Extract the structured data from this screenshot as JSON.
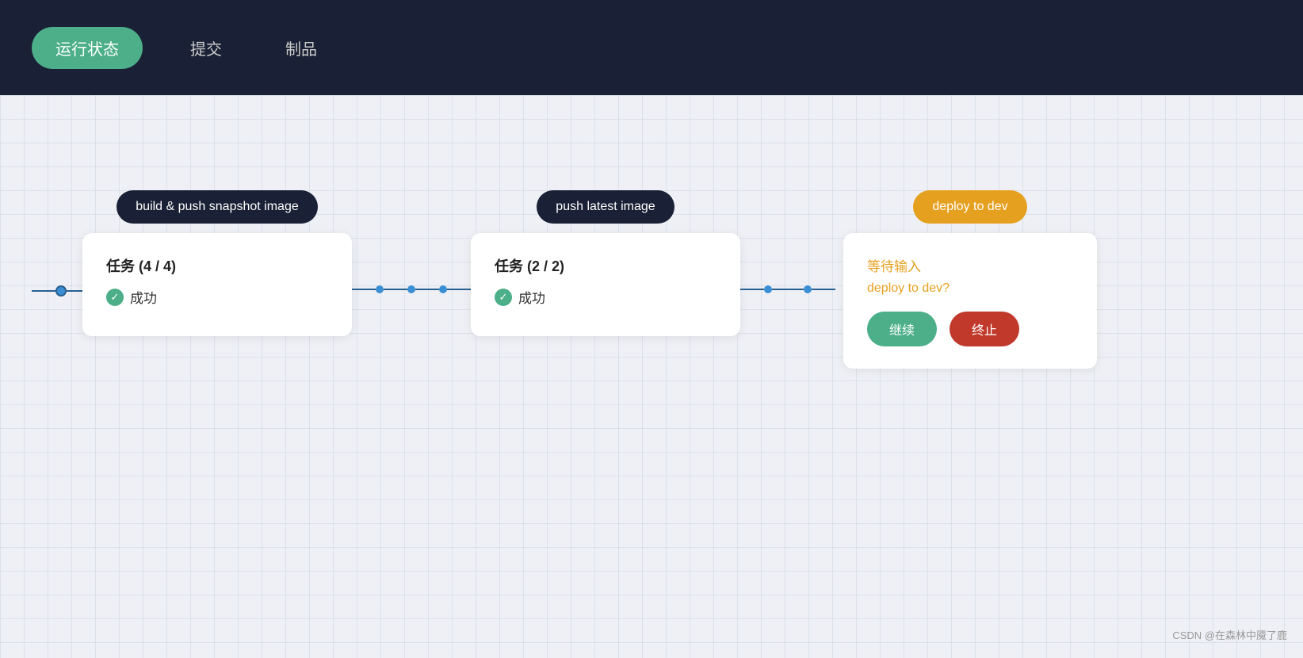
{
  "header": {
    "tabs": [
      {
        "id": "status",
        "label": "运行状态",
        "active": true
      },
      {
        "id": "commit",
        "label": "提交",
        "active": false
      },
      {
        "id": "artifact",
        "label": "制品",
        "active": false
      }
    ]
  },
  "pipeline": {
    "stages": [
      {
        "id": "stage1",
        "label": "build & push snapshot image",
        "label_style": "dark",
        "task_title": "任务 (4 / 4)",
        "status": "成功",
        "status_type": "success"
      },
      {
        "id": "stage2",
        "label": "push latest image",
        "label_style": "dark",
        "task_title": "任务 (2 / 2)",
        "status": "成功",
        "status_type": "success"
      },
      {
        "id": "stage3",
        "label": "deploy to dev",
        "label_style": "orange",
        "waiting_title": "等待输入",
        "waiting_question": "deploy to dev?",
        "btn_continue": "继续",
        "btn_stop": "终止",
        "status_type": "waiting"
      }
    ]
  },
  "watermark": "CSDN @在森林中魇了鹿"
}
